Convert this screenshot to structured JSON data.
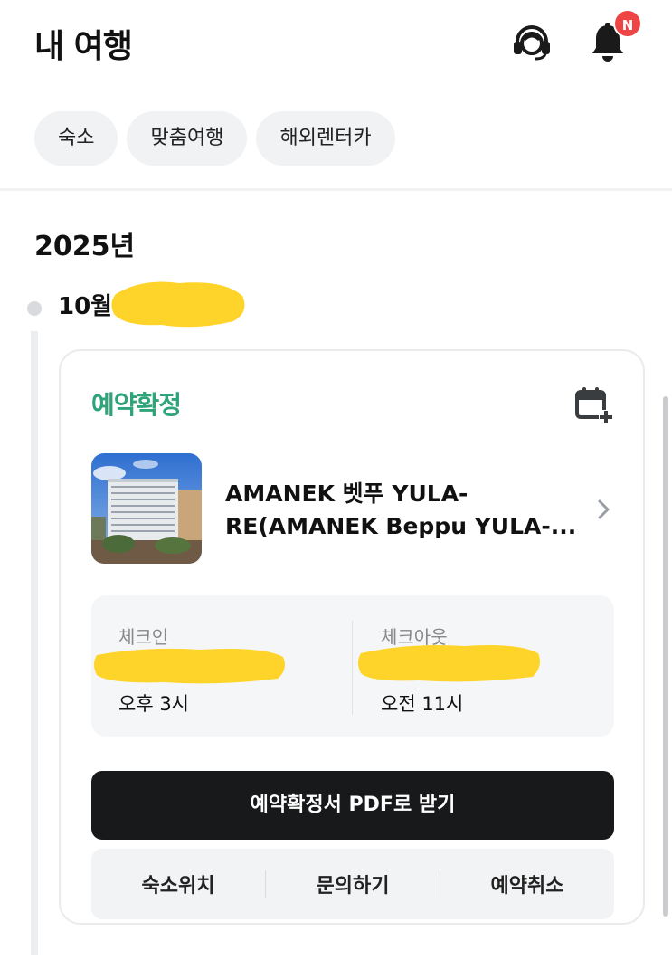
{
  "header": {
    "title": "내 여행",
    "support_icon": "headset-icon",
    "notification_icon": "bell-icon",
    "badge": "N",
    "badge_color": "#ee4444"
  },
  "tabs": [
    {
      "label": "숙소"
    },
    {
      "label": "맞춤여행"
    },
    {
      "label": "해외렌터카"
    }
  ],
  "timeline": {
    "year": "2025년",
    "month": "10월"
  },
  "booking": {
    "status": "예약확정",
    "status_color": "#2fa37a",
    "calendar_icon": "calendar-add-icon",
    "hotel_name_line1": "AMANEK 벳푸 YULA-",
    "hotel_name_line2": "RE(AMANEK Beppu YULA-...",
    "checkin": {
      "label": "체크인",
      "time": "오후 3시"
    },
    "checkout": {
      "label": "체크아웃",
      "time": "오전 11시"
    },
    "pdf_button": "예약확정서 PDF로 받기",
    "actions": {
      "location": "숙소위치",
      "inquiry": "문의하기",
      "cancel": "예약취소"
    }
  }
}
